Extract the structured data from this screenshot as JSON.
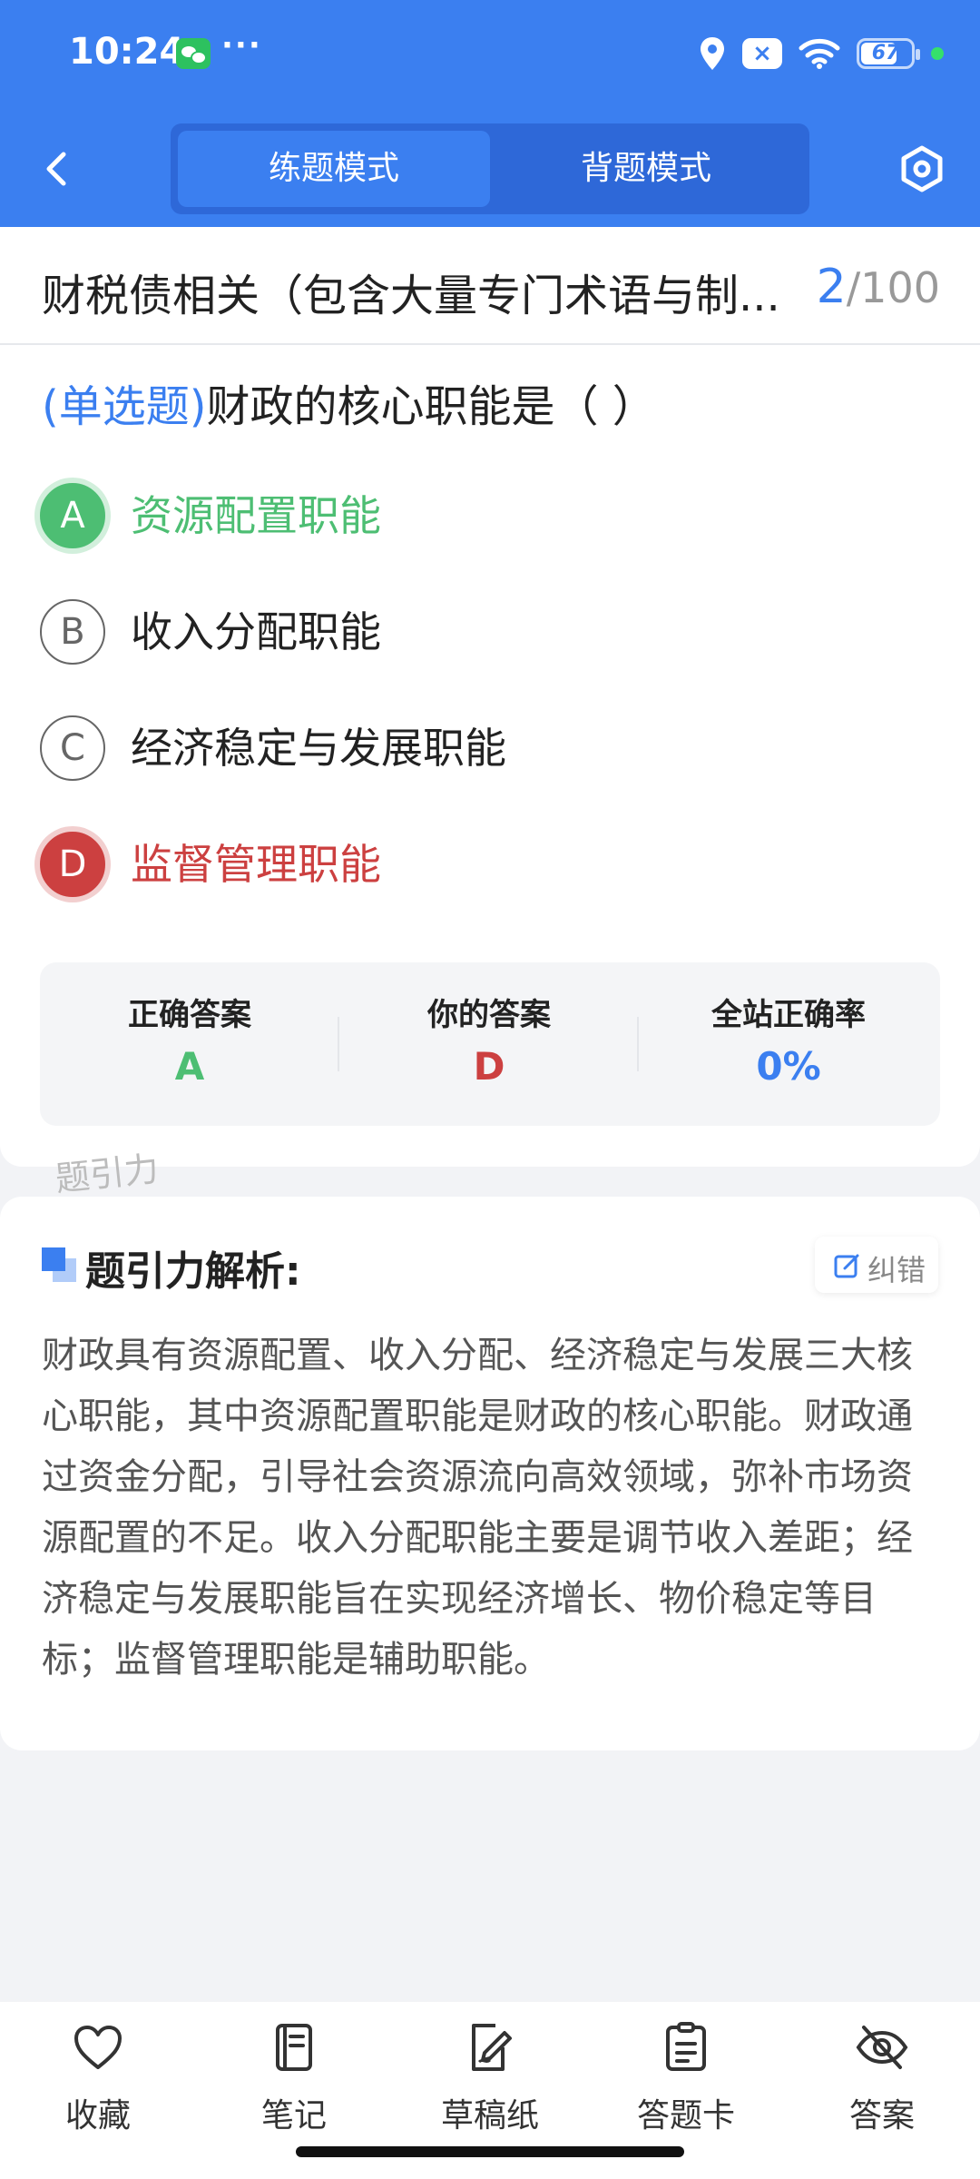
{
  "status_bar": {
    "time": "10:24",
    "more": "···",
    "x_badge": "×",
    "battery": "67"
  },
  "header": {
    "tabs": [
      {
        "label": "练题模式",
        "active": true
      },
      {
        "label": "背题模式",
        "active": false
      }
    ],
    "icons": {
      "back": "chevron-left-icon",
      "settings": "settings-hexagon-icon"
    }
  },
  "question_bank": {
    "title": "财税债相关（包含大量专门术语与制...",
    "current": "2",
    "total": "/100"
  },
  "question": {
    "type": "(单选题)",
    "text": "财政的核心职能是（        ）",
    "options": [
      {
        "letter": "A",
        "text": "资源配置职能",
        "state": "correct"
      },
      {
        "letter": "B",
        "text": "收入分配职能",
        "state": "normal"
      },
      {
        "letter": "C",
        "text": "经济稳定与发展职能",
        "state": "normal"
      },
      {
        "letter": "D",
        "text": "监督管理职能",
        "state": "wrong"
      }
    ]
  },
  "stats": [
    {
      "label": "正确答案",
      "value": "A",
      "color": "#4dbe73"
    },
    {
      "label": "你的答案",
      "value": "D",
      "color": "#cc4040"
    },
    {
      "label": "全站正确率",
      "value": "0%",
      "color": "#3b7ff0"
    }
  ],
  "watermark": "题引力",
  "analysis": {
    "title": "题引力解析:",
    "report_label": "纠错",
    "text": "财政具有资源配置、收入分配、经济稳定与发展三大核心职能，其中资源配置职能是财政的核心职能。财政通过资金分配，引导社会资源流向高效领域，弥补市场资源配置的不足。收入分配职能主要是调节收入差距；经济稳定与发展职能旨在实现经济增长、物价稳定等目标；监督管理职能是辅助职能。"
  },
  "bottom_nav": [
    {
      "label": "收藏",
      "icon": "heart-icon"
    },
    {
      "label": "笔记",
      "icon": "notebook-icon"
    },
    {
      "label": "草稿纸",
      "icon": "draft-paper-icon"
    },
    {
      "label": "答题卡",
      "icon": "answer-card-icon"
    },
    {
      "label": "答案",
      "icon": "eye-off-icon"
    }
  ],
  "colors": {
    "primary": "#3b7ff0",
    "correct": "#4dbe73",
    "wrong": "#cc4040"
  }
}
